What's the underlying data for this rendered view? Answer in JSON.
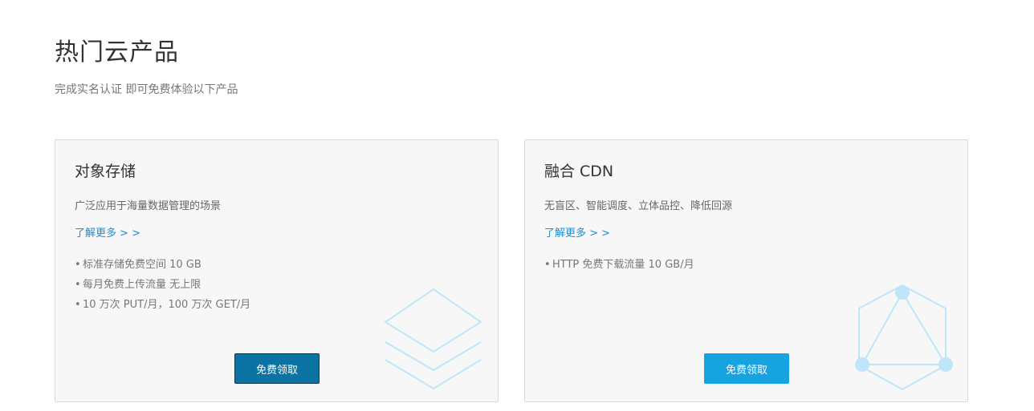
{
  "section": {
    "title": "热门云产品",
    "subtitle": "完成实名认证 即可免费体验以下产品"
  },
  "cards": [
    {
      "title": "对象存储",
      "description": "广泛应用于海量数据管理的场景",
      "link_label": "了解更多 > >",
      "features": [
        "标准存储免费空间 10 GB",
        "每月免费上传流量 无上限",
        "10 万次 PUT/月，100 万次 GET/月"
      ],
      "button_label": "免费领取",
      "button_color": "#0b73a3",
      "icon": "stacked-layers-icon"
    },
    {
      "title": "融合 CDN",
      "description": "无盲区、智能调度、立体品控、降低回源",
      "link_label": "了解更多 > >",
      "features": [
        "HTTP 免费下载流量 10 GB/月"
      ],
      "button_label": "免费领取",
      "button_color": "#17a3e0",
      "icon": "network-triangle-icon"
    }
  ],
  "colors": {
    "link": "#1b8fd0",
    "card_background": "#f7f7f7",
    "decoration": "#bfe6f8"
  }
}
